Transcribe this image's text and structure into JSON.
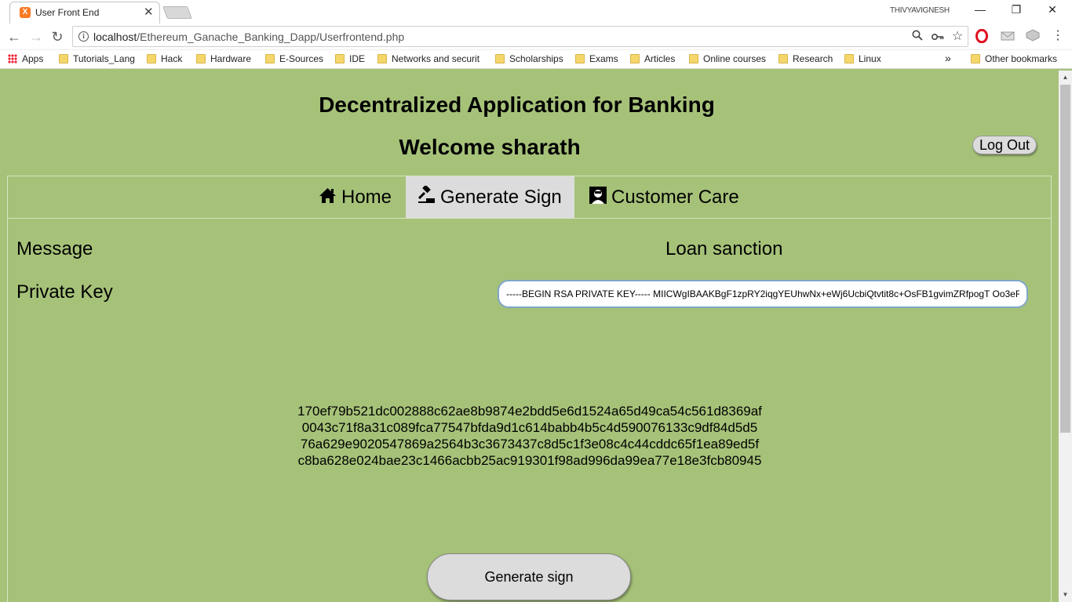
{
  "browser": {
    "tab_title": "User Front End",
    "tab_close": "✕",
    "favicon_text": "X",
    "profile_name": "THIVYAVIGNESH",
    "window_buttons": {
      "minimize": "—",
      "restore": "❐",
      "close": "✕"
    },
    "url_host": "localhost",
    "url_path": "/Ethereum_Ganache_Banking_Dapp/Userfrontend.php",
    "bookmarks": {
      "apps": "Apps",
      "items": [
        "Tutorials_Lang",
        "Hack",
        "Hardware",
        "E-Sources",
        "IDE",
        "Networks and securit",
        "Scholarships",
        "Exams",
        "Articles",
        "Online courses",
        "Research",
        "Linux"
      ],
      "overflow": "»",
      "other": "Other bookmarks"
    }
  },
  "page": {
    "heading": "Decentralized Application for Banking",
    "welcome": "Welcome sharath",
    "logout_label": "Log Out",
    "tabs": [
      {
        "label": "Home",
        "icon": "home-icon"
      },
      {
        "label": "Generate Sign",
        "icon": "gavel-icon",
        "active": true
      },
      {
        "label": "Customer Care",
        "icon": "support-agent-icon"
      }
    ],
    "form": {
      "message_label": "Message",
      "message_value": "Loan sanction",
      "private_key_label": "Private Key",
      "private_key_value": "-----BEGIN RSA PRIVATE KEY----- MIICWgIBAAKBgF1zpRY2iqgYEUhwNx+eWj6UcbiQtvtit8c+OsFB1gvimZRfpogT Oo3eF"
    },
    "signature_lines": [
      "170ef79b521dc002888c62ae8b9874e2bdd5e6d1524a65d49ca54c561d8369af",
      "0043c71f8a31c089fca77547bfda9d1c614babb4b5c4d590076133c9df84d5d5",
      "76a629e9020547869a2564b3c3673437c8d5c1f3e08c4c44cddc65f1ea89ed5f",
      "c8ba628e024bae23c1466acbb25ac919301f98ad996da99ea77e18e3fcb80945"
    ],
    "generate_button": "Generate sign"
  },
  "colors": {
    "page_background": "#a6c279",
    "active_tab": "#dcdcdc",
    "button": "#dcdcdc"
  }
}
